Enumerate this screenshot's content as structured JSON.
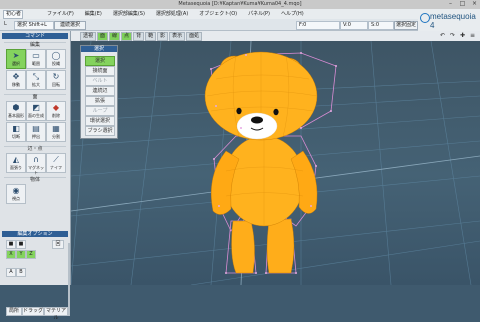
{
  "window": {
    "title": "Metasequoia [D:¥Kaptan¥Kuma¥Kuma04_4.mqo]"
  },
  "menubar": {
    "doc_box": "初心者",
    "items": [
      "ファイル(F)",
      "編集(E)",
      "選択部編集(S)",
      "選択部処理(A)",
      "オブジェクト(O)",
      "パネル(P)",
      "ヘルプ(H)"
    ]
  },
  "brand": {
    "name": "metasequoia 4"
  },
  "toolrow": {
    "prefix": "L",
    "field1": "選択 Shift+L",
    "btn_select": "連続選択",
    "coord_x_label": "F:0",
    "coord_y_label": "V:0",
    "coord_z_label": "S:0",
    "fix_btn": "選択固定"
  },
  "subbar": {
    "left_text": "各",
    "buttons": [
      {
        "label": "透視",
        "active": false
      },
      {
        "label": "面",
        "active": true
      },
      {
        "label": "線",
        "active": true
      },
      {
        "label": "点",
        "active": true
      },
      {
        "label": "背",
        "active": false
      },
      {
        "label": "範",
        "active": false
      },
      {
        "label": "影",
        "active": false
      },
      {
        "label": "表示",
        "active": false
      },
      {
        "label": "面処",
        "active": false
      }
    ],
    "icons": [
      "undo-icon",
      "redo-icon",
      "zoom-icon",
      "menu-icon"
    ]
  },
  "leftpanel": {
    "command_head": "コマンド",
    "groups": [
      "編集",
      "面",
      "辺・点",
      "物体"
    ],
    "tools_edit": [
      {
        "label": "選択",
        "icon": "cursor-icon",
        "active": true
      },
      {
        "label": "範囲",
        "icon": "rect-icon",
        "active": false
      },
      {
        "label": "投縄",
        "icon": "lasso-icon",
        "active": false
      },
      {
        "label": "移動",
        "icon": "move-icon",
        "active": false
      },
      {
        "label": "拡大",
        "icon": "scale-icon",
        "active": false
      },
      {
        "label": "回転",
        "icon": "rotate-icon",
        "active": false
      }
    ],
    "tools_face": [
      {
        "label": "基本図形",
        "icon": "shape-icon"
      },
      {
        "label": "面の生成",
        "icon": "face-icon"
      },
      {
        "label": "削除",
        "icon": "delete-icon"
      },
      {
        "label": "切断",
        "icon": "cut-icon"
      },
      {
        "label": "押出",
        "icon": "extrude-icon"
      },
      {
        "label": "分割",
        "icon": "split-icon"
      }
    ],
    "tools_edge": [
      {
        "label": "面張り",
        "icon": "fill-icon"
      },
      {
        "label": "マグネット",
        "icon": "magnet-icon"
      },
      {
        "label": "ナイフ",
        "icon": "knife-icon"
      }
    ],
    "tools_object": [
      {
        "label": "視点",
        "icon": "eye-icon"
      }
    ],
    "options_head": "編集オプション",
    "options": [
      "■",
      "■",
      "回",
      "X",
      "Y",
      "Z",
      "A",
      "B"
    ],
    "bottom_row": [
      "局所",
      "ドラッグ",
      "マテリアル"
    ]
  },
  "floatpanel": {
    "head": "選択",
    "items": [
      {
        "label": "選択",
        "active": true,
        "disabled": false
      },
      {
        "label": "接続面",
        "active": false,
        "disabled": false
      },
      {
        "label": "ベルト",
        "active": false,
        "disabled": true
      },
      {
        "label": "連続辺",
        "active": false,
        "disabled": false
      },
      {
        "label": "拡張",
        "active": false,
        "disabled": false
      },
      {
        "label": "ループ",
        "active": false,
        "disabled": true
      },
      {
        "label": "環状選択",
        "active": false,
        "disabled": false
      },
      {
        "label": "ブラシ選択",
        "active": false,
        "disabled": false
      }
    ]
  },
  "colors": {
    "accent": "#2f5f95",
    "active": "#84d35e",
    "bear": "#ffb21e",
    "viewport": "#456275"
  }
}
